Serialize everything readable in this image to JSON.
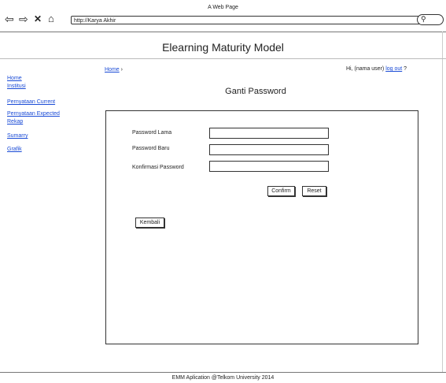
{
  "window": {
    "title": "A Web Page"
  },
  "browser": {
    "url": "http://Karya Akhir"
  },
  "app": {
    "title": "Elearning Maturity Model"
  },
  "breadcrumb": {
    "home": "Home",
    "separator": "›"
  },
  "greeting": {
    "prefix": "Hi, (nama user)",
    "logout": "log out",
    "suffix": "?"
  },
  "sidebar": {
    "items": [
      "Home",
      "Institusi",
      "Pernyataan Current",
      "Pernyataan Expected",
      "Rekap",
      "Sumarry",
      "Grafik"
    ]
  },
  "page": {
    "heading": "Ganti Password"
  },
  "form": {
    "old_password_label": "Password Lama",
    "new_password_label": "Password Baru",
    "confirm_password_label": "Konfirmasi Password",
    "confirm_button": "Confirm",
    "reset_button": "Reset",
    "back_button": "Kembali"
  },
  "footer": {
    "text": "EMM Aplication @Telkom University 2014"
  },
  "icons": {
    "back": "arrow-left-icon",
    "forward": "arrow-right-icon",
    "stop": "close-icon",
    "home": "home-icon",
    "search": "search-icon"
  }
}
